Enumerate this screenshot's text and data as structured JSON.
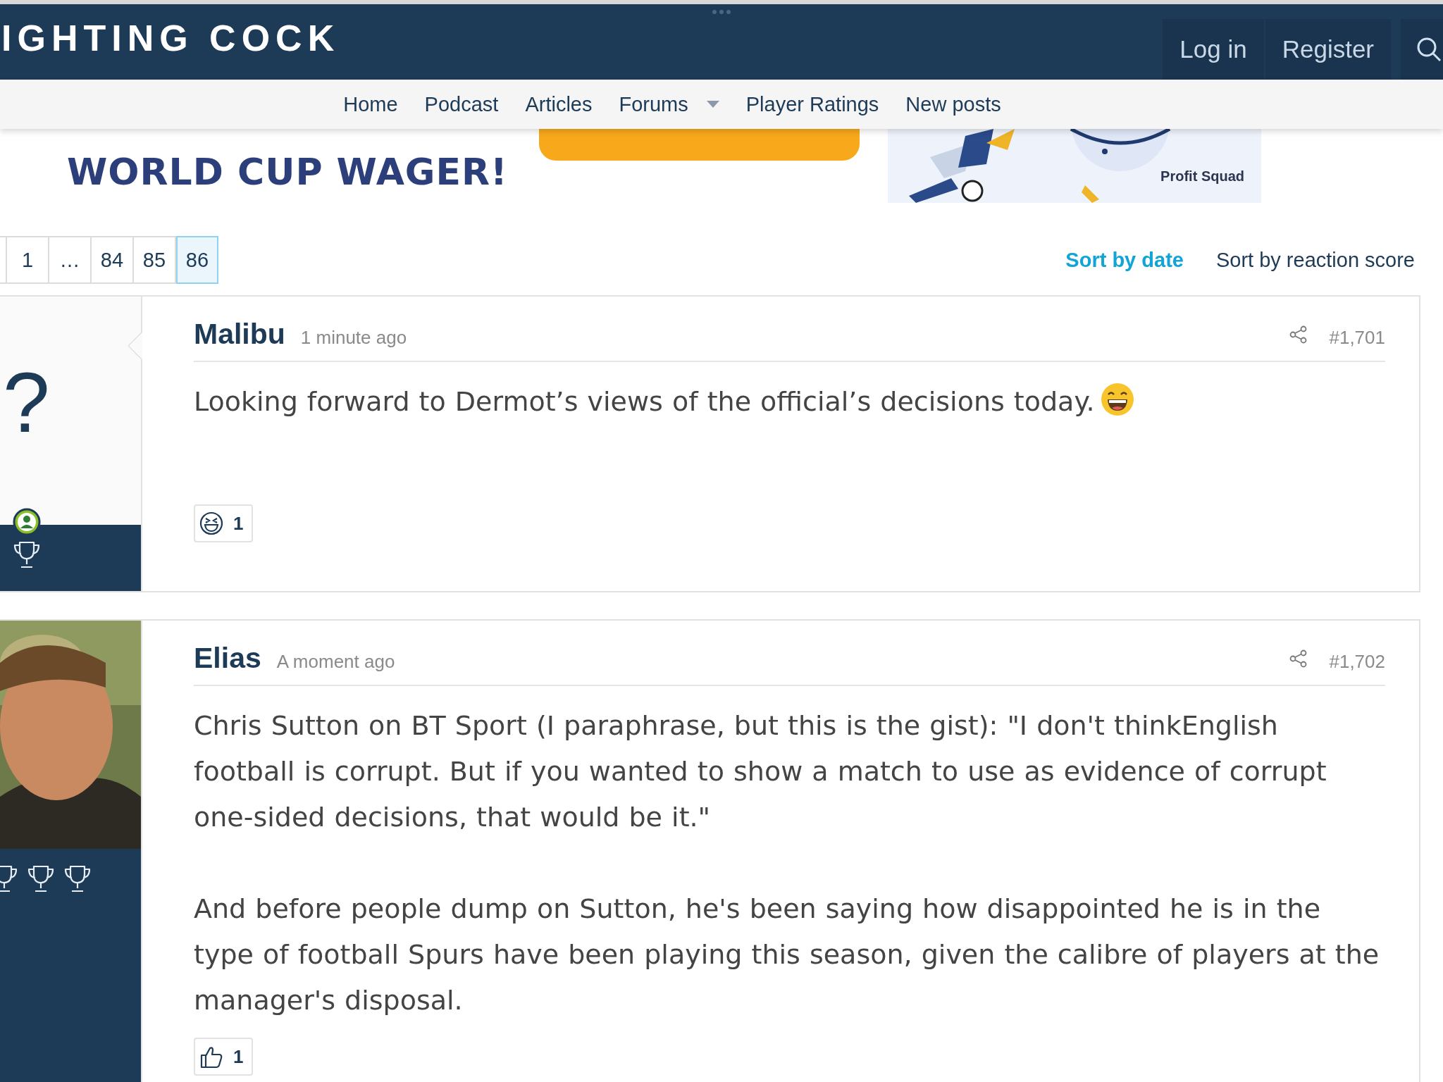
{
  "header": {
    "site_title": "IGHTING COCK",
    "actions": [
      "Log in",
      "Register"
    ]
  },
  "nav": [
    {
      "label": "Home",
      "has_menu": false
    },
    {
      "label": "Podcast",
      "has_menu": false
    },
    {
      "label": "Articles",
      "has_menu": false
    },
    {
      "label": "Forums",
      "has_menu": true
    },
    {
      "label": "Player Ratings",
      "has_menu": false
    },
    {
      "label": "New posts",
      "has_menu": false
    }
  ],
  "banner": {
    "headline": "WORLD CUP WAGER!",
    "brand": "Profit Squad"
  },
  "pagination": [
    {
      "label": "1",
      "selected": false
    },
    {
      "label": "…",
      "selected": false
    },
    {
      "label": "84",
      "selected": false
    },
    {
      "label": "85",
      "selected": false
    },
    {
      "label": "86",
      "selected": true
    }
  ],
  "sort": [
    {
      "label": "Sort by date",
      "selected": true
    },
    {
      "label": "Sort by reaction score",
      "selected": false
    }
  ],
  "posts": [
    {
      "author": "Malibu",
      "time": "1 minute ago",
      "number": "#1,701",
      "avatar": {
        "kind": "placeholder",
        "text": "?"
      },
      "online": true,
      "badges": [
        {
          "kind": "trophy"
        }
      ],
      "paragraphs": [
        {
          "text": "Looking forward to Dermot’s views of the official’s decisions today.",
          "has_emoji": true
        }
      ],
      "reaction": {
        "kind": "laugh",
        "count": "1"
      }
    },
    {
      "author": "Elias",
      "time": "A moment ago",
      "number": "#1,702",
      "avatar": {
        "kind": "picture"
      },
      "online": false,
      "badges": [
        {
          "kind": "trophy"
        },
        {
          "kind": "trophy"
        },
        {
          "kind": "trophy"
        }
      ],
      "paragraphs": [
        {
          "text": "Chris Sutton on BT Sport (I paraphrase, but this is the gist): \"I don't thinkEnglish football is corrupt. But if you wanted to show a match to use as evidence of corrupt one-sided decisions, that would be it.\""
        },
        {
          "text": "And before people dump on Sutton, he's been saying how disappointed he is in the type of football Spurs have been playing this season, given the calibre of players at the manager's disposal."
        }
      ],
      "reaction": {
        "kind": "like",
        "count": "1"
      }
    }
  ]
}
